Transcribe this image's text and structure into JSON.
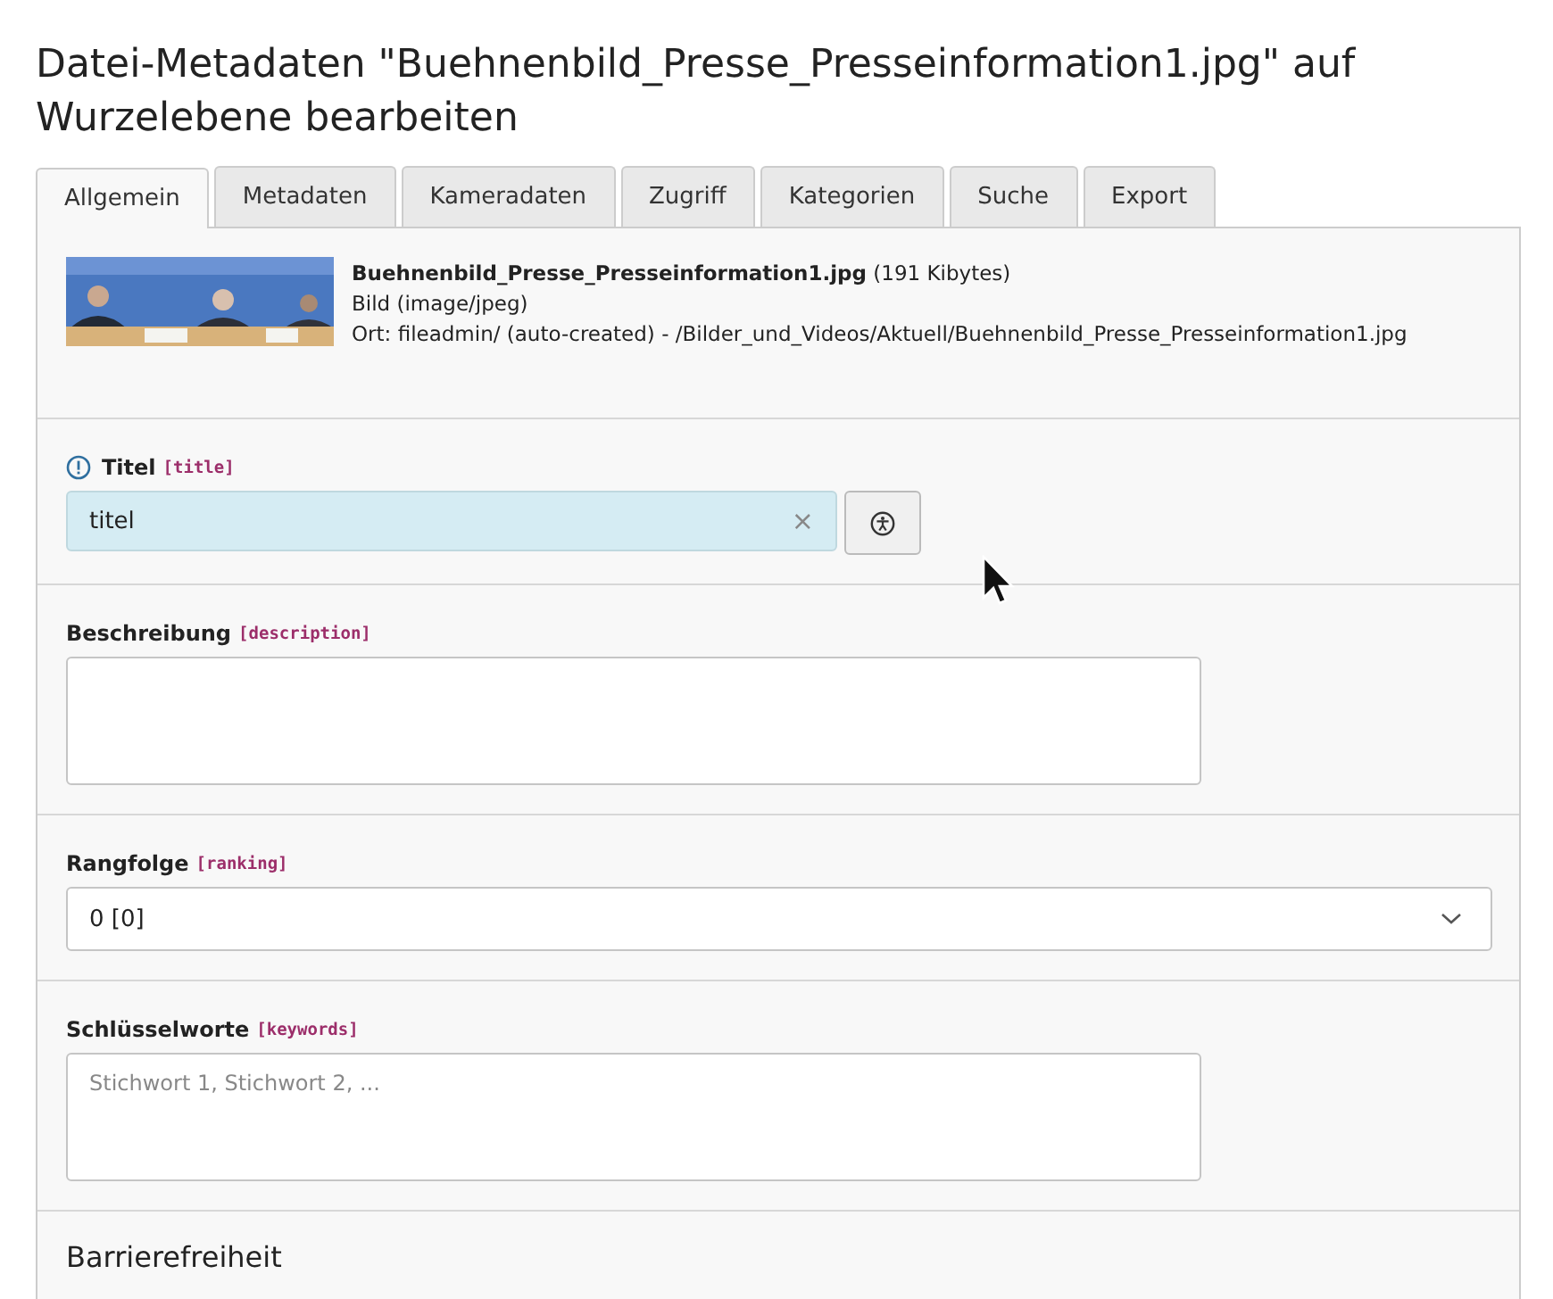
{
  "page_title": "Datei-Metadaten \"Buehnenbild_Presse_Presseinformation1.jpg\" auf Wurzelebene bearbeiten",
  "tabs": [
    {
      "label": "Allgemein",
      "selected": true
    },
    {
      "label": "Metadaten",
      "selected": false
    },
    {
      "label": "Kameradaten",
      "selected": false
    },
    {
      "label": "Zugriff",
      "selected": false
    },
    {
      "label": "Kategorien",
      "selected": false
    },
    {
      "label": "Suche",
      "selected": false
    },
    {
      "label": "Export",
      "selected": false
    }
  ],
  "file": {
    "name": "Buehnenbild_Presse_Presseinformation1.jpg",
    "size": "(191 Kibytes)",
    "type": "Bild (image/jpeg)",
    "location": "Ort: fileadmin/ (auto-created) - /Bilder_und_Videos/Aktuell/Buehnenbild_Presse_Presseinformation1.jpg"
  },
  "sections": [
    {
      "kind": "text",
      "label": "Titel",
      "key": "[title]",
      "required": true,
      "value": "titel",
      "clear": "×"
    },
    {
      "kind": "textarea",
      "label": "Beschreibung",
      "key": "[description]",
      "required": false
    },
    {
      "kind": "select",
      "label": "Rangfolge",
      "key": "[ranking]",
      "required": false,
      "value": "0 [0]"
    },
    {
      "kind": "textarea",
      "label": "Schlüsselworte",
      "key": "[keywords]",
      "required": false,
      "placeholder": "Stichwort 1, Stichwort 2, ..."
    },
    {
      "kind": "heading",
      "heading": "Barrierefreiheit"
    }
  ]
}
